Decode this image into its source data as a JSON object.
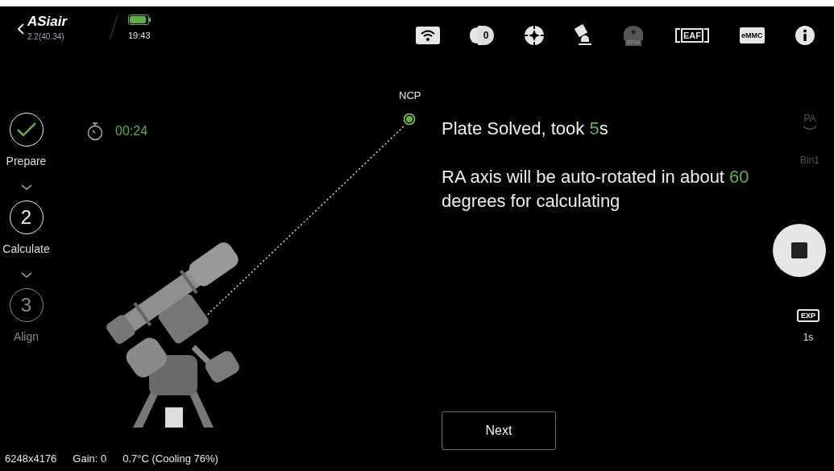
{
  "header": {
    "app_name": "ASiair",
    "version": "2.2(40.34)",
    "time": "19:43",
    "battery": {
      "level": 0.9
    }
  },
  "toolbar": [
    {
      "kind": "wifi",
      "disabled": false
    },
    {
      "kind": "camera",
      "label": "0",
      "disabled": false
    },
    {
      "kind": "target",
      "disabled": false
    },
    {
      "kind": "mount",
      "disabled": false
    },
    {
      "kind": "efw",
      "label": "EFW",
      "disabled": true
    },
    {
      "kind": "eaf",
      "label": "EAF",
      "disabled": false
    },
    {
      "kind": "emmc",
      "label": "eMMC",
      "disabled": false
    },
    {
      "kind": "info",
      "disabled": false
    }
  ],
  "steps": [
    {
      "kind": "check",
      "label": "Prepare",
      "disabled": false
    },
    {
      "kind": "number",
      "number": "2",
      "label": "Calculate",
      "disabled": false
    },
    {
      "kind": "number",
      "number": "3",
      "label": "Align",
      "disabled": true
    }
  ],
  "timer": "00:24",
  "pole_marker": "NCP",
  "messages": [
    [
      {
        "text": "Plate Solved, took ",
        "highlight": false
      },
      {
        "text": "5",
        "highlight": true
      },
      {
        "text": "s",
        "highlight": false
      }
    ],
    [
      {
        "text": "RA axis will be auto-rotated in about ",
        "highlight": false
      },
      {
        "text": "60",
        "highlight": true
      },
      {
        "text": " degrees for calculating",
        "highlight": false
      }
    ]
  ],
  "next_button": "Next",
  "side_controls": {
    "pa": "PA",
    "bin": "Bin1",
    "exposure_badge": "EXP",
    "exposure": "1s"
  },
  "status_bar": [
    "6248x4176",
    "Gain: 0",
    "0.7°C (Cooling 76%)"
  ]
}
